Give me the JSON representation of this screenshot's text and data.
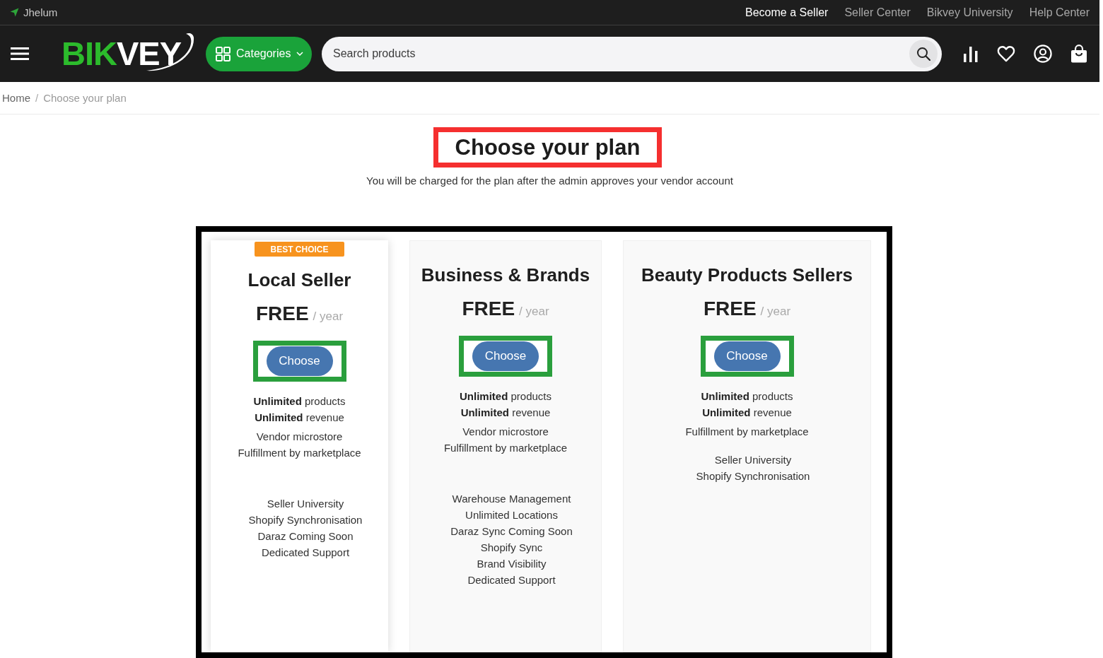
{
  "top_bar": {
    "location": "Jhelum",
    "links": [
      {
        "label": "Become a Seller",
        "emphasized": true
      },
      {
        "label": "Seller Center",
        "emphasized": false
      },
      {
        "label": "Bikvey University",
        "emphasized": false
      },
      {
        "label": "Help Center",
        "emphasized": false
      }
    ]
  },
  "header": {
    "logo": [
      {
        "text": "BIK",
        "color": "#2cbb2c"
      },
      {
        "text": "VEY",
        "color": "#ffffff"
      }
    ],
    "categories_button": "Categories",
    "search": {
      "placeholder": "Search products"
    }
  },
  "breadcrumb": {
    "separator": "/",
    "items": [
      {
        "label": "Home",
        "current": false
      },
      {
        "label": "Choose your plan",
        "current": true
      }
    ]
  },
  "page": {
    "title": "Choose your plan",
    "subtitle": "You will be charged for the plan after the admin approves your vendor account"
  },
  "plans": [
    {
      "badge": "BEST CHOICE",
      "featured": true,
      "name": "Local Seller",
      "price": "FREE",
      "period": "/ year",
      "button": "Choose",
      "feature_groups": [
        [
          "**Unlimited** products",
          "**Unlimited** revenue"
        ],
        [
          "Vendor microstore",
          "Fulfillment by marketplace"
        ],
        [
          "Seller University",
          "Shopify Synchronisation",
          "Daraz Coming Soon",
          "Dedicated Support"
        ]
      ]
    },
    {
      "featured": false,
      "name": "Business & Brands",
      "price": "FREE",
      "period": "/ year",
      "button": "Choose",
      "feature_groups": [
        [
          "**Unlimited** products",
          "**Unlimited** revenue"
        ],
        [
          "Vendor microstore",
          "Fulfillment by marketplace"
        ],
        [
          "Warehouse Management",
          "Unlimited Locations",
          "Daraz Sync Coming Soon",
          "Shopify Sync",
          "Brand Visibility",
          "Dedicated Support"
        ]
      ]
    },
    {
      "featured": false,
      "name": "Beauty Products Sellers",
      "price": "FREE",
      "period": "/ year",
      "button": "Choose",
      "feature_groups": [
        [
          "**Unlimited** products",
          "**Unlimited** revenue"
        ],
        [
          "Fulfillment by marketplace"
        ],
        [
          "Seller University",
          "Shopify Synchronisation"
        ]
      ]
    }
  ]
}
